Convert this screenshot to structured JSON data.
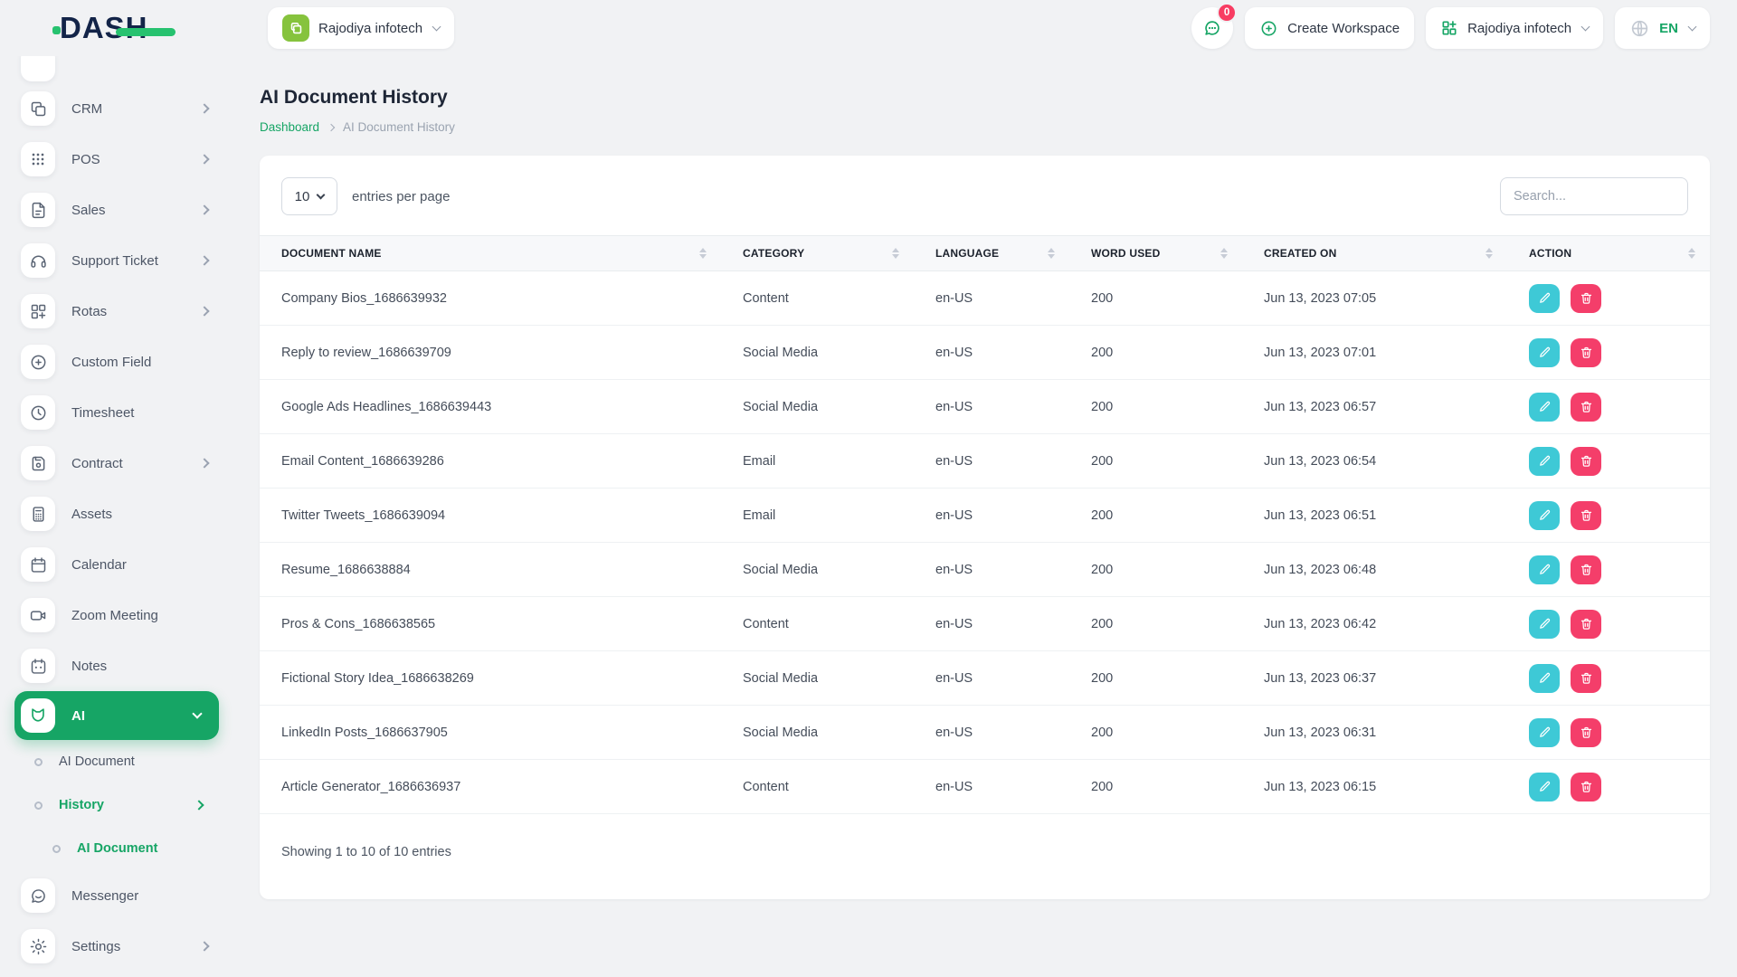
{
  "colors": {
    "primary_green": "#16a565",
    "logo_green": "#27c26f",
    "logo_navy": "#132448",
    "workspace_avatar_lime": "#86c33d",
    "edit_teal": "#3ec9d6",
    "delete_pink": "#f43e6a",
    "badge_red": "#f83c62"
  },
  "brand": {
    "logo_text": "DASH"
  },
  "topbar": {
    "workspace_switcher": {
      "label": "Rajodiya infotech"
    },
    "messages": {
      "badge_count": "0"
    },
    "create_workspace": {
      "label": "Create Workspace"
    },
    "account_menu": {
      "label": "Rajodiya infotech"
    },
    "language_menu": {
      "label": "EN"
    }
  },
  "sidebar": {
    "items": [
      {
        "label": "CRM",
        "icon": "copy-icon",
        "has_chevron": true
      },
      {
        "label": "POS",
        "icon": "grid-dots-icon",
        "has_chevron": true
      },
      {
        "label": "Sales",
        "icon": "document-icon",
        "has_chevron": true
      },
      {
        "label": "Support Ticket",
        "icon": "headset-icon",
        "has_chevron": true
      },
      {
        "label": "Rotas",
        "icon": "grid-plus-icon",
        "has_chevron": true
      },
      {
        "label": "Custom Field",
        "icon": "plus-circle-icon",
        "has_chevron": false
      },
      {
        "label": "Timesheet",
        "icon": "clock-icon",
        "has_chevron": false
      },
      {
        "label": "Contract",
        "icon": "floppy-icon",
        "has_chevron": true
      },
      {
        "label": "Assets",
        "icon": "calculator-icon",
        "has_chevron": false
      },
      {
        "label": "Calendar",
        "icon": "calendar-icon",
        "has_chevron": false
      },
      {
        "label": "Zoom Meeting",
        "icon": "video-camera-icon",
        "has_chevron": false
      },
      {
        "label": "Notes",
        "icon": "notes-icon",
        "has_chevron": false
      },
      {
        "label": "AI",
        "icon": "ai-fox-icon",
        "active": true,
        "chevron": "down"
      }
    ],
    "ai_submenu": [
      {
        "label": "AI Document",
        "active": false
      },
      {
        "label": "History",
        "active": true,
        "has_chevron": true
      },
      {
        "label": "AI Document",
        "active": true,
        "level": 2
      }
    ],
    "footer_items": [
      {
        "label": "Messenger",
        "icon": "chat-bubble-icon",
        "has_chevron": false
      },
      {
        "label": "Settings",
        "icon": "gear-icon",
        "has_chevron": true
      }
    ]
  },
  "page": {
    "title": "AI Document History",
    "breadcrumb": {
      "root": "Dashboard",
      "current": "AI Document History"
    }
  },
  "controls": {
    "page_size_value": "10",
    "page_size_suffix": "entries per page",
    "search_placeholder": "Search..."
  },
  "table": {
    "columns": [
      {
        "label": "DOCUMENT NAME"
      },
      {
        "label": "CATEGORY"
      },
      {
        "label": "LANGUAGE"
      },
      {
        "label": "WORD USED"
      },
      {
        "label": "CREATED ON"
      },
      {
        "label": "ACTION"
      }
    ],
    "rows": [
      {
        "name": "Company Bios_1686639932",
        "category": "Content",
        "language": "en-US",
        "word_used": "200",
        "created_on": "Jun 13, 2023 07:05"
      },
      {
        "name": "Reply to review_1686639709",
        "category": "Social Media",
        "language": "en-US",
        "word_used": "200",
        "created_on": "Jun 13, 2023 07:01"
      },
      {
        "name": "Google Ads Headlines_1686639443",
        "category": "Social Media",
        "language": "en-US",
        "word_used": "200",
        "created_on": "Jun 13, 2023 06:57"
      },
      {
        "name": "Email Content_1686639286",
        "category": "Email",
        "language": "en-US",
        "word_used": "200",
        "created_on": "Jun 13, 2023 06:54"
      },
      {
        "name": "Twitter Tweets_1686639094",
        "category": "Email",
        "language": "en-US",
        "word_used": "200",
        "created_on": "Jun 13, 2023 06:51"
      },
      {
        "name": "Resume_1686638884",
        "category": "Social Media",
        "language": "en-US",
        "word_used": "200",
        "created_on": "Jun 13, 2023 06:48"
      },
      {
        "name": "Pros & Cons_1686638565",
        "category": "Content",
        "language": "en-US",
        "word_used": "200",
        "created_on": "Jun 13, 2023 06:42"
      },
      {
        "name": "Fictional Story Idea_1686638269",
        "category": "Social Media",
        "language": "en-US",
        "word_used": "200",
        "created_on": "Jun 13, 2023 06:37"
      },
      {
        "name": "LinkedIn Posts_1686637905",
        "category": "Social Media",
        "language": "en-US",
        "word_used": "200",
        "created_on": "Jun 13, 2023 06:31"
      },
      {
        "name": "Article Generator_1686636937",
        "category": "Content",
        "language": "en-US",
        "word_used": "200",
        "created_on": "Jun 13, 2023 06:15"
      }
    ],
    "summary": "Showing 1 to 10 of 10 entries"
  }
}
